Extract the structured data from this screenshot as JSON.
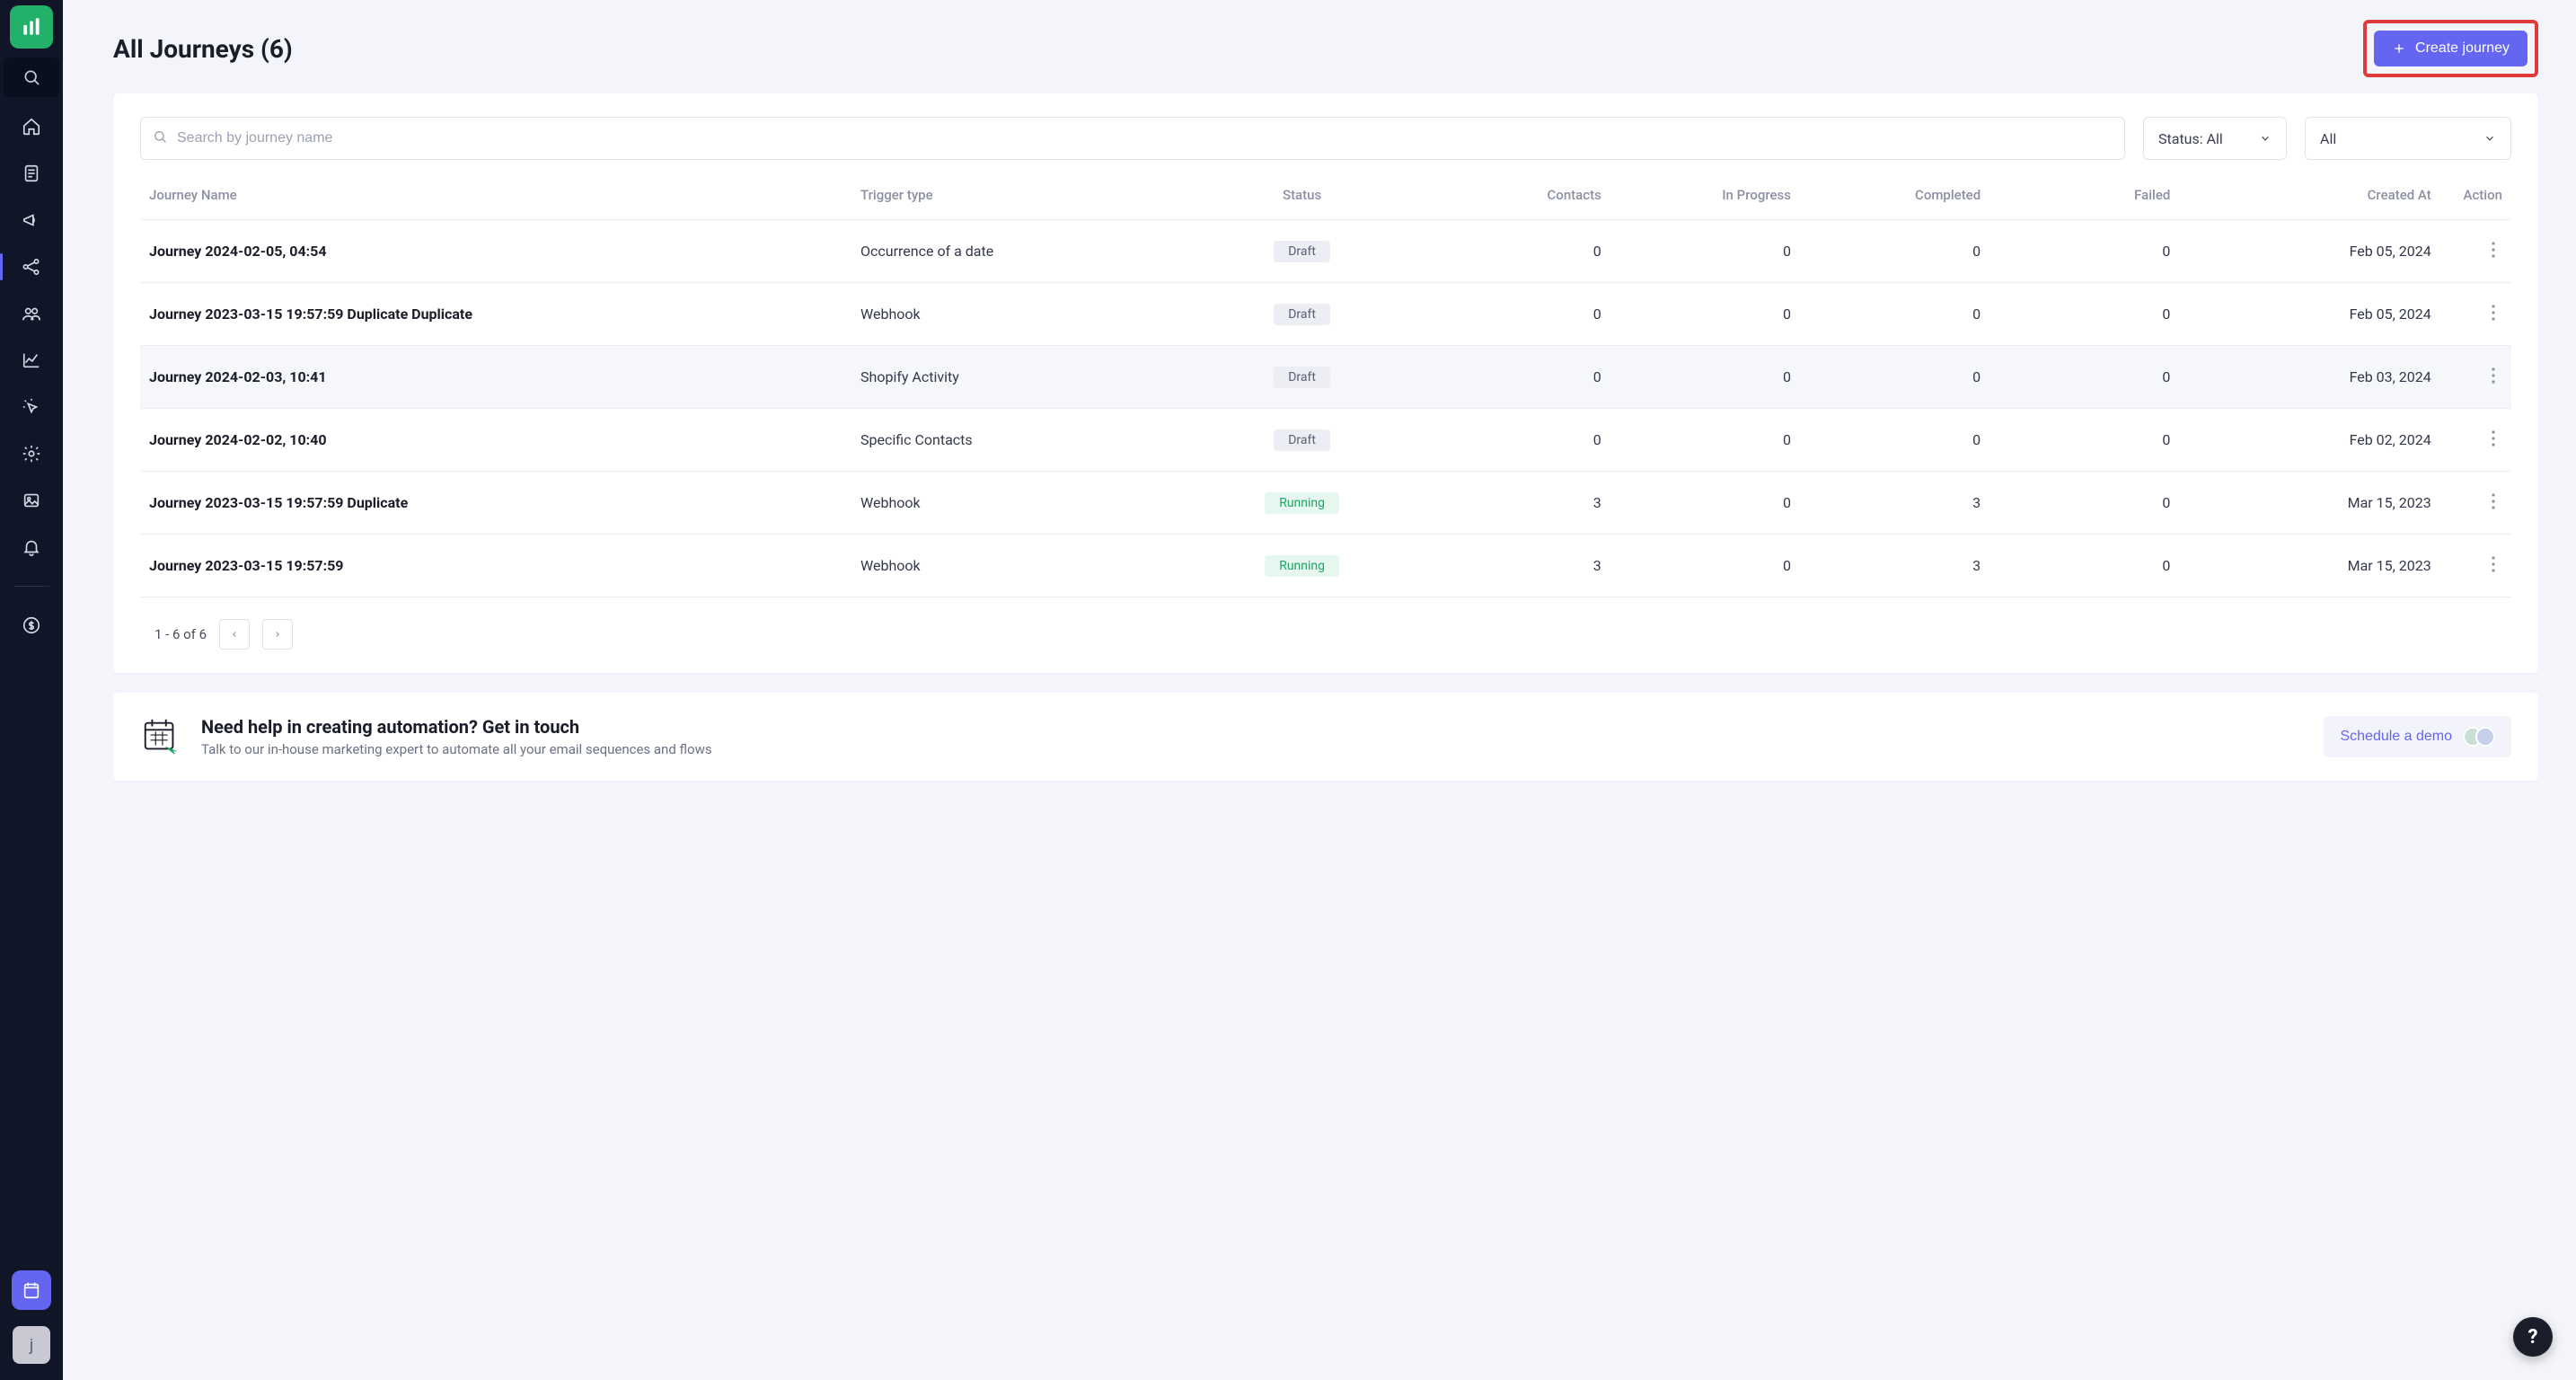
{
  "page": {
    "title": "All Journeys (6)",
    "create_label": "Create journey"
  },
  "search": {
    "placeholder": "Search by journey name"
  },
  "filters": {
    "status_label": "Status: All",
    "extra_label": "All"
  },
  "table": {
    "headers": {
      "name": "Journey Name",
      "trigger": "Trigger type",
      "status": "Status",
      "contacts": "Contacts",
      "inprogress": "In Progress",
      "completed": "Completed",
      "failed": "Failed",
      "created": "Created At",
      "action": "Action"
    },
    "rows": [
      {
        "name": "Journey 2024-02-05, 04:54",
        "trigger": "Occurrence of a date",
        "status": "Draft",
        "status_kind": "draft",
        "contacts": "0",
        "inprogress": "0",
        "completed": "0",
        "failed": "0",
        "created": "Feb 05, 2024",
        "hovered": false
      },
      {
        "name": "Journey 2023-03-15 19:57:59 Duplicate Duplicate",
        "trigger": "Webhook",
        "status": "Draft",
        "status_kind": "draft",
        "contacts": "0",
        "inprogress": "0",
        "completed": "0",
        "failed": "0",
        "created": "Feb 05, 2024",
        "hovered": false
      },
      {
        "name": "Journey 2024-02-03, 10:41",
        "trigger": "Shopify Activity",
        "status": "Draft",
        "status_kind": "draft",
        "contacts": "0",
        "inprogress": "0",
        "completed": "0",
        "failed": "0",
        "created": "Feb 03, 2024",
        "hovered": true
      },
      {
        "name": "Journey 2024-02-02, 10:40",
        "trigger": "Specific Contacts",
        "status": "Draft",
        "status_kind": "draft",
        "contacts": "0",
        "inprogress": "0",
        "completed": "0",
        "failed": "0",
        "created": "Feb 02, 2024",
        "hovered": false
      },
      {
        "name": "Journey 2023-03-15 19:57:59 Duplicate",
        "trigger": "Webhook",
        "status": "Running",
        "status_kind": "running",
        "contacts": "3",
        "inprogress": "0",
        "completed": "3",
        "failed": "0",
        "created": "Mar 15, 2023",
        "hovered": false
      },
      {
        "name": "Journey 2023-03-15 19:57:59",
        "trigger": "Webhook",
        "status": "Running",
        "status_kind": "running",
        "contacts": "3",
        "inprogress": "0",
        "completed": "3",
        "failed": "0",
        "created": "Mar 15, 2023",
        "hovered": false
      }
    ]
  },
  "pagination": {
    "range": "1 - 6 of 6"
  },
  "promo": {
    "title": "Need help in creating automation? Get in touch",
    "subtitle": "Talk to our in-house marketing expert to automate all your email sequences and flows",
    "cta": "Schedule a demo"
  },
  "help": {
    "label": "?"
  },
  "avatar": {
    "initial": "j"
  }
}
